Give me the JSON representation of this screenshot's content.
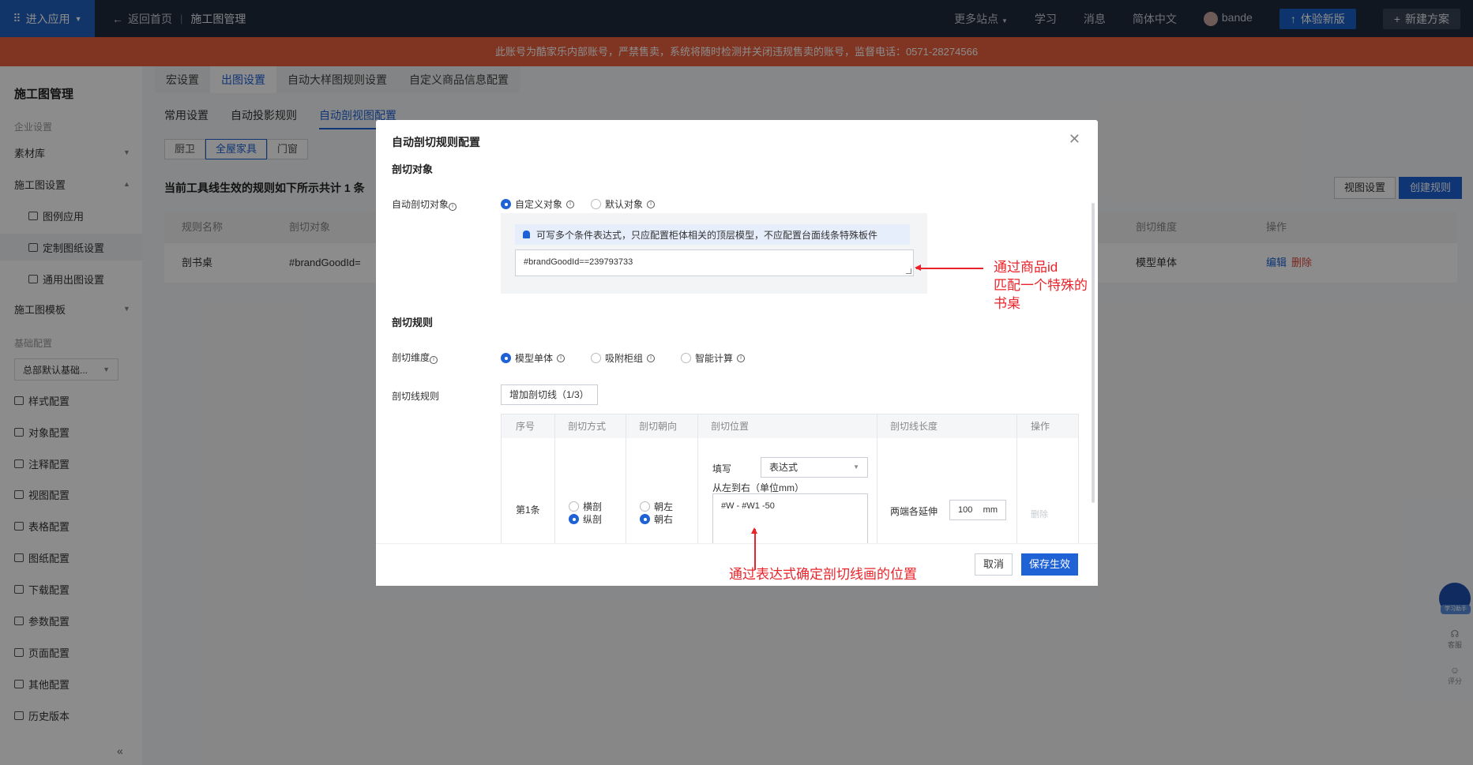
{
  "topbar": {
    "app_btn": "进入应用",
    "back": "返回首页",
    "current": "施工图管理",
    "more_sites": "更多站点",
    "learn": "学习",
    "messages": "消息",
    "language": "简体中文",
    "user": "bande",
    "try_new": "体验新版",
    "new_plan": "新建方案"
  },
  "banner": {
    "text": "此账号为酷家乐内部账号，严禁售卖，系统将随时检测并关闭违规售卖的账号，监督电话：0571-28274566"
  },
  "sidebar": {
    "title": "施工图管理",
    "group_enterprise": "企业设置",
    "material_lib": "素材库",
    "construction_settings": "施工图设置",
    "legend_apply": "图例应用",
    "custom_drawing": "定制图纸设置",
    "general_output": "通用出图设置",
    "template": "施工图模板",
    "group_base": "基础配置",
    "base_select": "总部默认基础...",
    "style": "样式配置",
    "object": "对象配置",
    "annotation": "注释配置",
    "view": "视图配置",
    "table": "表格配置",
    "frame": "图纸配置",
    "download": "下载配置",
    "param": "参数配置",
    "page": "页面配置",
    "other": "其他配置",
    "history": "历史版本"
  },
  "main": {
    "tabs1": [
      "宏设置",
      "出图设置",
      "自动大样图规则设置",
      "自定义商品信息配置"
    ],
    "tabs2": [
      "常用设置",
      "自动投影规则",
      "自动剖视图配置"
    ],
    "seg": [
      "厨卫",
      "全屋家具",
      "门窗"
    ],
    "rule_count": "当前工具线生效的规则如下所示共计 1 条",
    "view_settings": "视图设置",
    "create_rule": "创建规则",
    "table_head": [
      "规则名称",
      "剖切对象",
      "剖切维度",
      "操作"
    ],
    "row": {
      "name": "剖书桌",
      "object": "#brandGoodId=",
      "dimension": "模型单体",
      "edit": "编辑",
      "delete": "删除"
    }
  },
  "modal": {
    "title": "自动剖切规则配置",
    "sec_object": "剖切对象",
    "label_auto_object": "自动剖切对象",
    "opt_custom": "自定义对象",
    "opt_default": "默认对象",
    "tip": "可写多个条件表达式，只应配置柜体相关的顶层模型，不应配置台面线条特殊板件",
    "expr": "#brandGoodId==239793733",
    "sec_rule": "剖切规则",
    "label_dimension": "剖切维度",
    "opt_model": "模型单体",
    "opt_cabinet": "吸附柜组",
    "opt_smart": "智能计算",
    "label_line_rule": "剖切线规则",
    "add_line": "增加剖切线（1/3）",
    "rt_head": [
      "序号",
      "剖切方式",
      "剖切朝向",
      "剖切位置",
      "剖切线长度",
      "操作"
    ],
    "rt_row": {
      "index": "第1条",
      "cut_h": "横剖",
      "cut_v": "纵剖",
      "dir_l": "朝左",
      "dir_r": "朝右",
      "fill": "填写",
      "fill_mode": "表达式",
      "ltr": "从左到右（单位mm）",
      "pos_expr": "#W - #W1 -50",
      "extend": "两端各延伸",
      "extend_val": "100",
      "unit": "mm",
      "del": "删除"
    },
    "cancel": "取消",
    "save": "保存生效"
  },
  "annotations": {
    "a1_l1": "通过商品id",
    "a1_l2": "匹配一个特殊的",
    "a1_l3": "书桌",
    "a2": "通过表达式确定剖切线画的位置"
  },
  "float": {
    "bot": "学习助手",
    "support": "客服",
    "feedback": "评分"
  },
  "colors": {
    "primary": "#1e62d6",
    "banner": "#e8613f",
    "topbar": "#1f2a3d",
    "annotation": "#e8242a"
  }
}
